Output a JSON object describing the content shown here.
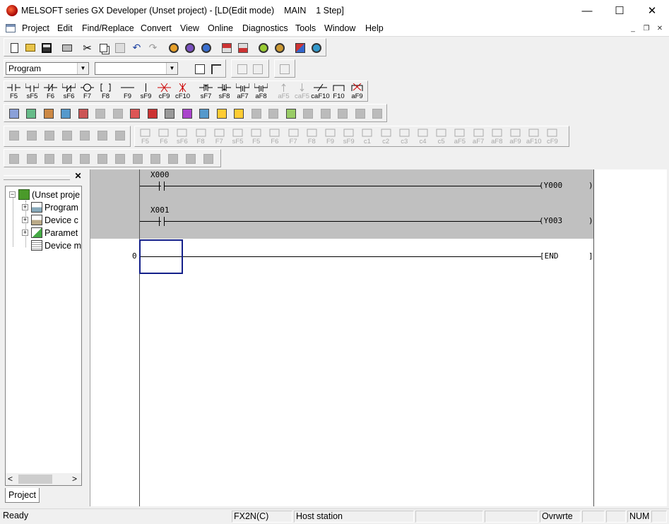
{
  "window": {
    "title": "MELSOFT series GX Developer (Unset project) - [LD(Edit mode)    MAIN    1 Step]",
    "controls": {
      "minimize": "—",
      "maximize": "☐",
      "close": "✕"
    }
  },
  "menubar": {
    "items": [
      "Project",
      "Edit",
      "Find/Replace",
      "Convert",
      "View",
      "Online",
      "Diagnostics",
      "Tools",
      "Window",
      "Help"
    ],
    "mdi_controls": {
      "minimize": "_",
      "restore": "❐",
      "close": "✕"
    }
  },
  "toolbar": {
    "program_select": {
      "value": "Program"
    },
    "device_select": {
      "value": ""
    },
    "ladder_buttons": [
      {
        "key": "F5",
        "symbol": "no-contact"
      },
      {
        "key": "sF5",
        "symbol": "parallel-no-contact"
      },
      {
        "key": "F6",
        "symbol": "nc-contact"
      },
      {
        "key": "sF6",
        "symbol": "parallel-nc-contact"
      },
      {
        "key": "F7",
        "symbol": "coil"
      },
      {
        "key": "F8",
        "symbol": "application-instruction"
      },
      {
        "key": "F9",
        "symbol": "horizontal-line"
      },
      {
        "key": "sF9",
        "symbol": "vertical-line"
      },
      {
        "key": "cF9",
        "symbol": "delete-horizontal-line"
      },
      {
        "key": "cF10",
        "symbol": "delete-vertical-line"
      },
      {
        "key": "sF7",
        "symbol": "rising-pulse"
      },
      {
        "key": "sF8",
        "symbol": "falling-pulse"
      },
      {
        "key": "aF7",
        "symbol": "parallel-rising-pulse"
      },
      {
        "key": "aF8",
        "symbol": "parallel-falling-pulse"
      },
      {
        "key": "aF5",
        "symbol": "operation-result-rising",
        "disabled": true
      },
      {
        "key": "caF5",
        "symbol": "operation-result-falling",
        "disabled": true
      },
      {
        "key": "caF10",
        "symbol": "invert-operation"
      },
      {
        "key": "F10",
        "symbol": "draw-line"
      },
      {
        "key": "aF9",
        "symbol": "delete-line"
      }
    ],
    "sfc_buttons": [
      "F5",
      "F6",
      "sF6",
      "F8",
      "F7",
      "sF5",
      "F5",
      "F6",
      "F7",
      "F8",
      "F9",
      "sF9",
      "c1",
      "c2",
      "c3",
      "c4",
      "c5",
      "aF5",
      "aF7",
      "aF8",
      "aF9",
      "aF10",
      "cF9"
    ]
  },
  "project_tree": {
    "items": [
      {
        "label": "(Unset proje",
        "icon": "project-icon",
        "expander": "−",
        "level": 0
      },
      {
        "label": "Program",
        "icon": "program-folder-icon",
        "expander": "+",
        "level": 1
      },
      {
        "label": "Device c",
        "icon": "device-comment-icon",
        "expander": "+",
        "level": 1
      },
      {
        "label": "Paramet",
        "icon": "parameter-icon",
        "expander": "+",
        "level": 1
      },
      {
        "label": "Device m",
        "icon": "device-memory-icon",
        "expander": "",
        "level": 1
      }
    ],
    "scroll_left": "<",
    "scroll_right": ">",
    "tab": "Project"
  },
  "ladder": {
    "rungs": [
      {
        "step": "",
        "contact": "X000",
        "coil": "Y000",
        "selected": true
      },
      {
        "step": "",
        "contact": "X001",
        "coil": "Y003",
        "selected": true
      },
      {
        "step": "0",
        "contact": "",
        "coil": "END",
        "selected": false
      }
    ]
  },
  "statusbar": {
    "ready": "Ready",
    "plc": "FX2N(C)",
    "station": "Host station",
    "mode": "Ovrwrte",
    "num": "NUM"
  }
}
